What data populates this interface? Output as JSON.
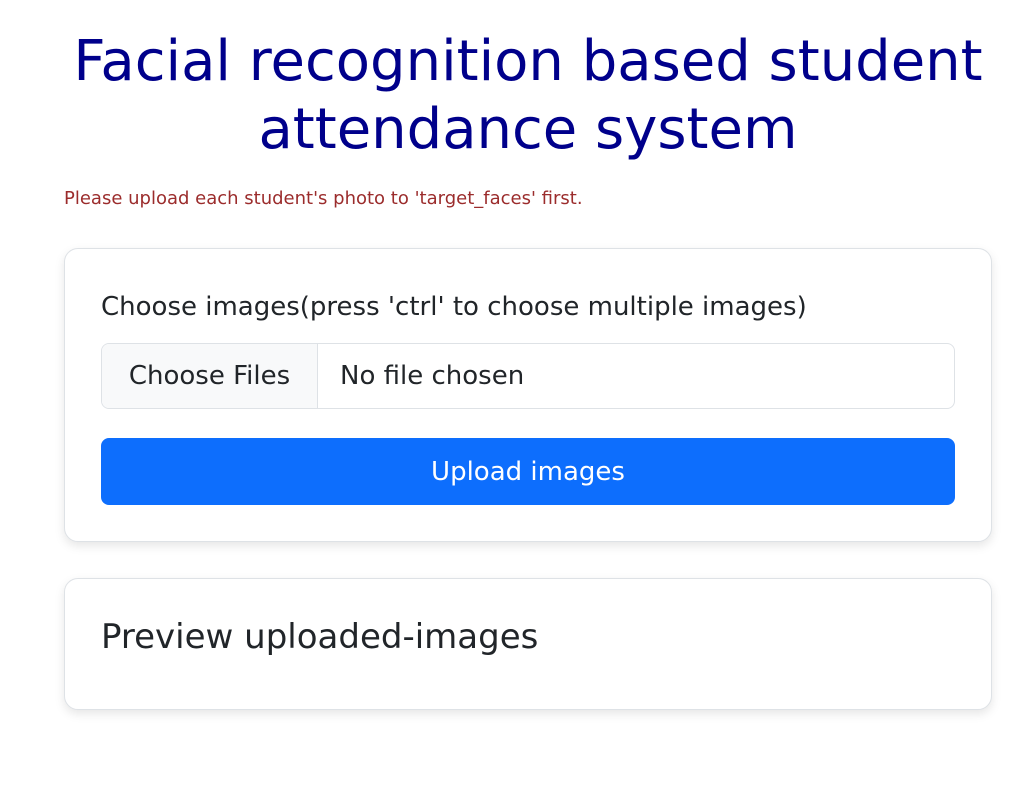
{
  "header": {
    "title": "Facial recognition based student attendance system",
    "notice": "Please upload each student's photo to 'target_faces' first."
  },
  "upload_card": {
    "label": "Choose images(press 'ctrl' to choose multiple images)",
    "choose_files_label": "Choose Files",
    "file_status": "No file chosen",
    "upload_button_label": "Upload images"
  },
  "preview_card": {
    "title": "Preview uploaded-images"
  },
  "colors": {
    "title": "#00008b",
    "notice": "#9b2c2c",
    "primary_button": "#0d6efd"
  }
}
